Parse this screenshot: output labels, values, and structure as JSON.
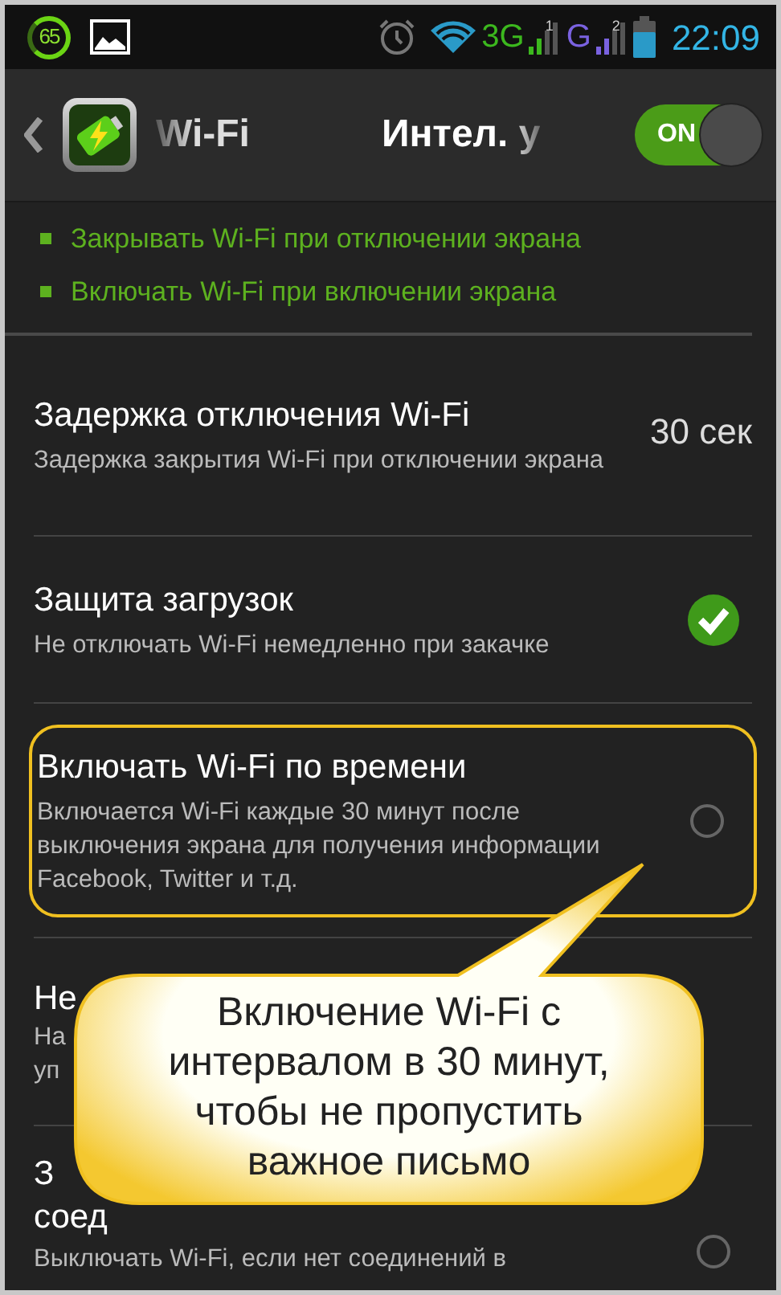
{
  "status_bar": {
    "battery_badge": "65",
    "network_3g": "3G",
    "sim_1": "1",
    "network_g": "G",
    "sim_2": "2",
    "time": "22:09"
  },
  "action_bar": {
    "tab_left": "Wi-Fi",
    "tab_center": "Интел. у",
    "toggle": {
      "label": "ON",
      "on": true
    }
  },
  "bullets": [
    {
      "text": "Закрывать Wi-Fi при отключении экрана"
    },
    {
      "text": "Включать Wi-Fi при включении экрана"
    }
  ],
  "settings": [
    {
      "kind": "value",
      "title": "Задержка отключения Wi-Fi",
      "description": "Задержка закрытия Wi-Fi при отключении экрана",
      "value": "30 сек",
      "highlighted": false
    },
    {
      "kind": "checkbox",
      "title": "Защита загрузок",
      "description": "Не отключать Wi-Fi немедленно при закачке",
      "checked": true,
      "highlighted": false
    },
    {
      "kind": "checkbox",
      "title": "Включать Wi-Fi по времени",
      "description": "Включается Wi-Fi каждые 30 минут после выключения экрана для получения информации Facebook, Twitter и т.д.",
      "checked": false,
      "highlighted": true
    },
    {
      "kind": "partial",
      "title_lines": [
        "Не"
      ],
      "description_lines": [
        "На",
        "уп"
      ],
      "highlighted": false
    },
    {
      "kind": "checkbox",
      "title_lines": [
        "З",
        "соед"
      ],
      "description": "Выключать Wi-Fi, если нет соединений в",
      "checked": false,
      "highlighted": false
    }
  ],
  "callout": {
    "lines": [
      "Включение Wi-Fi с",
      "интервалом в 30 минут,",
      "чтобы не пропустить",
      "важное письмо"
    ]
  }
}
